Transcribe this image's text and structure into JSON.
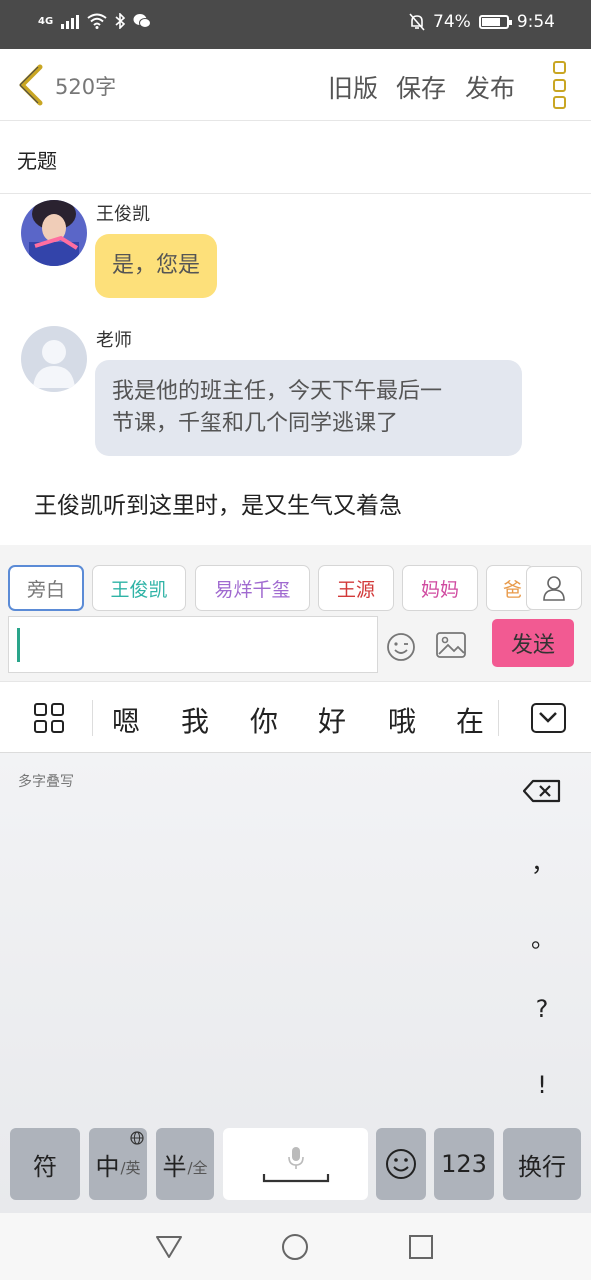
{
  "status_bar": {
    "network": "4G",
    "battery_percent": "74%",
    "battery_level": 0.74,
    "time": "9:54"
  },
  "header": {
    "word_count": "520字",
    "old_version_label": "旧版",
    "save_label": "保存",
    "publish_label": "发布"
  },
  "document": {
    "title": "无题"
  },
  "messages": [
    {
      "sender": "王俊凯",
      "text": "是，您是"
    },
    {
      "sender": "老师",
      "text_lines": [
        "我是他的班主任，今天下午最后一",
        "节课，千玺和几个同学逃课了"
      ]
    }
  ],
  "narration": "王俊凯听到这里时，是又生气又着急",
  "roles": [
    {
      "label": "旁白",
      "color": "#777777"
    },
    {
      "label": "王俊凯",
      "color": "#2fb3a6"
    },
    {
      "label": "易烊千玺",
      "color": "#a06ad0"
    },
    {
      "label": "王源",
      "color": "#d23a3a"
    },
    {
      "label": "妈妈",
      "color": "#d04aa0"
    },
    {
      "label": "爸",
      "color": "#e89a4a"
    }
  ],
  "composer": {
    "send_label": "发送"
  },
  "keyboard": {
    "candidates": [
      "嗯",
      "我",
      "你",
      "好",
      "哦",
      "在"
    ],
    "handwriting_label": "多字叠写",
    "punctuation": [
      "，",
      "。",
      "?",
      "!"
    ],
    "keys": {
      "symbols": "符",
      "chinese": "中",
      "chinese_sub": "/英",
      "half": "半",
      "half_sub": "/全",
      "numbers": "123",
      "enter": "换行"
    }
  },
  "colors": {
    "user_bubble": "#fde07a",
    "teacher_bubble": "#e3e7ef",
    "send_button": "#f25a92",
    "accent": "#c9a623"
  }
}
